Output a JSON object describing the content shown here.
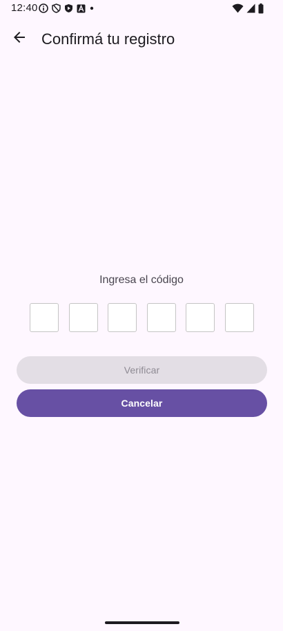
{
  "status_bar": {
    "time": "12:40"
  },
  "app_bar": {
    "title": "Confirmá tu registro",
    "back_icon": "arrow-back-icon"
  },
  "verification": {
    "label": "Ingresa el código",
    "digits": [
      "",
      "",
      "",
      "",
      "",
      ""
    ]
  },
  "actions": {
    "verify_label": "Verificar",
    "cancel_label": "Cancelar"
  },
  "colors": {
    "background": "#FEF7FF",
    "primary": "#6750A4",
    "disabled_button": "#E3DEE5",
    "disabled_text": "#8E8A93"
  }
}
